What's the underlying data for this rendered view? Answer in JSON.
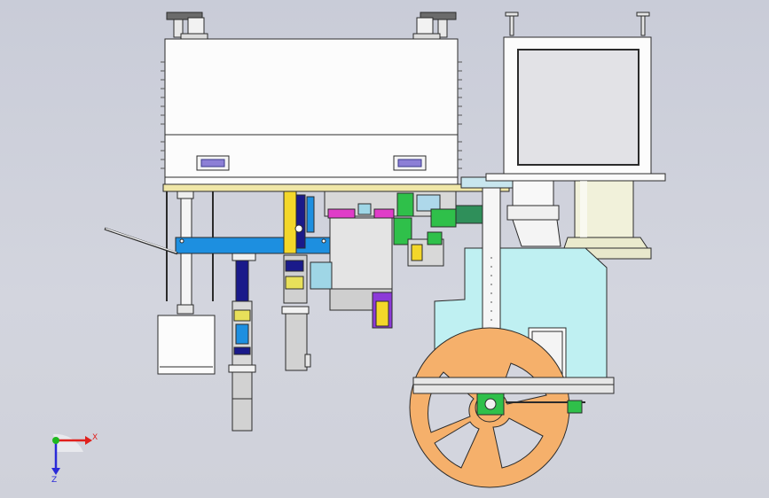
{
  "viewport": {
    "background": "#cdd0da"
  },
  "triad": {
    "x_label": "X",
    "z_label": "Z",
    "x_color": "#e0201c",
    "z_color": "#2a2ad8",
    "origin_color": "#1fb81f"
  },
  "colors": {
    "line": "#2b2b2b",
    "panel_white": "#fcfcfc",
    "handle": "#8c7fd6",
    "rail_yellow": "#f0e7a8",
    "arm_blue": "#1d8fe0",
    "bracket_cyan": "#bff0f2",
    "reel_orange": "#f5b06b",
    "cylinder_cream": "#f1f1da",
    "motor_gray": "#d2d2d2",
    "magenta": "#e03cc8",
    "green": "#2fc04a",
    "navy": "#1a1a8a"
  },
  "icons": [
    "axis-triad-icon",
    "leveling-foot-icon"
  ]
}
